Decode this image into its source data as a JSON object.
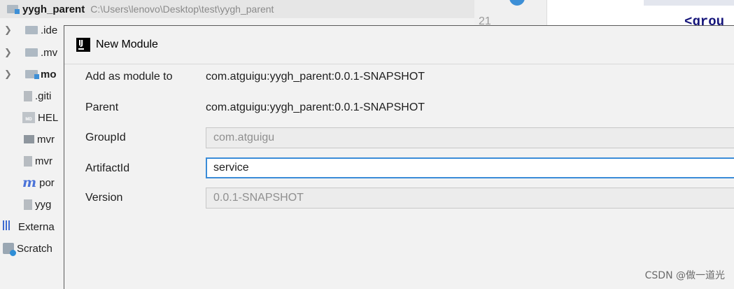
{
  "project": {
    "name": "yygh_parent",
    "path": "C:\\Users\\lenovo\\Desktop\\test\\yygh_parent"
  },
  "tree": {
    "items": [
      {
        "label": ".ide",
        "icon": "folder-icon",
        "expandable": true
      },
      {
        "label": ".mv",
        "icon": "folder-icon",
        "expandable": true
      },
      {
        "label": "mo",
        "icon": "module-folder-icon",
        "expandable": true
      },
      {
        "label": ".giti",
        "icon": "gitignore-file-icon",
        "expandable": false
      },
      {
        "label": "HEL",
        "icon": "markdown-file-icon",
        "expandable": false
      },
      {
        "label": "mvr",
        "icon": "mvnw-script-icon",
        "expandable": false
      },
      {
        "label": "mvr",
        "icon": "mvnw-cmd-file-icon",
        "expandable": false
      },
      {
        "label": "por",
        "icon": "maven-pom-icon",
        "expandable": false
      },
      {
        "label": "yyg",
        "icon": "iml-file-icon",
        "expandable": false
      },
      {
        "label": "Externa",
        "icon": "external-libraries-icon",
        "expandable": false
      },
      {
        "label": "Scratch",
        "icon": "scratches-icon",
        "expandable": false
      }
    ]
  },
  "editor": {
    "line_number": "21",
    "code_fragment": "<grou"
  },
  "dialog": {
    "title": "New Module",
    "rows": {
      "add_as_module": {
        "label": "Add as module to",
        "value": "com.atguigu:yygh_parent:0.0.1-SNAPSHOT"
      },
      "parent": {
        "label": "Parent",
        "value": "com.atguigu:yygh_parent:0.0.1-SNAPSHOT"
      },
      "group_id": {
        "label": "GroupId",
        "value": "com.atguigu"
      },
      "artifact_id": {
        "label": "ArtifactId",
        "value": "service"
      },
      "version": {
        "label": "Version",
        "value": "0.0.1-SNAPSHOT"
      }
    }
  },
  "watermark": "CSDN @做一道光",
  "colors": {
    "accent": "#3a8cd8",
    "folder": "#aeb9c3",
    "module_badge": "#3d8fd6",
    "maven": "#4a72d8"
  }
}
